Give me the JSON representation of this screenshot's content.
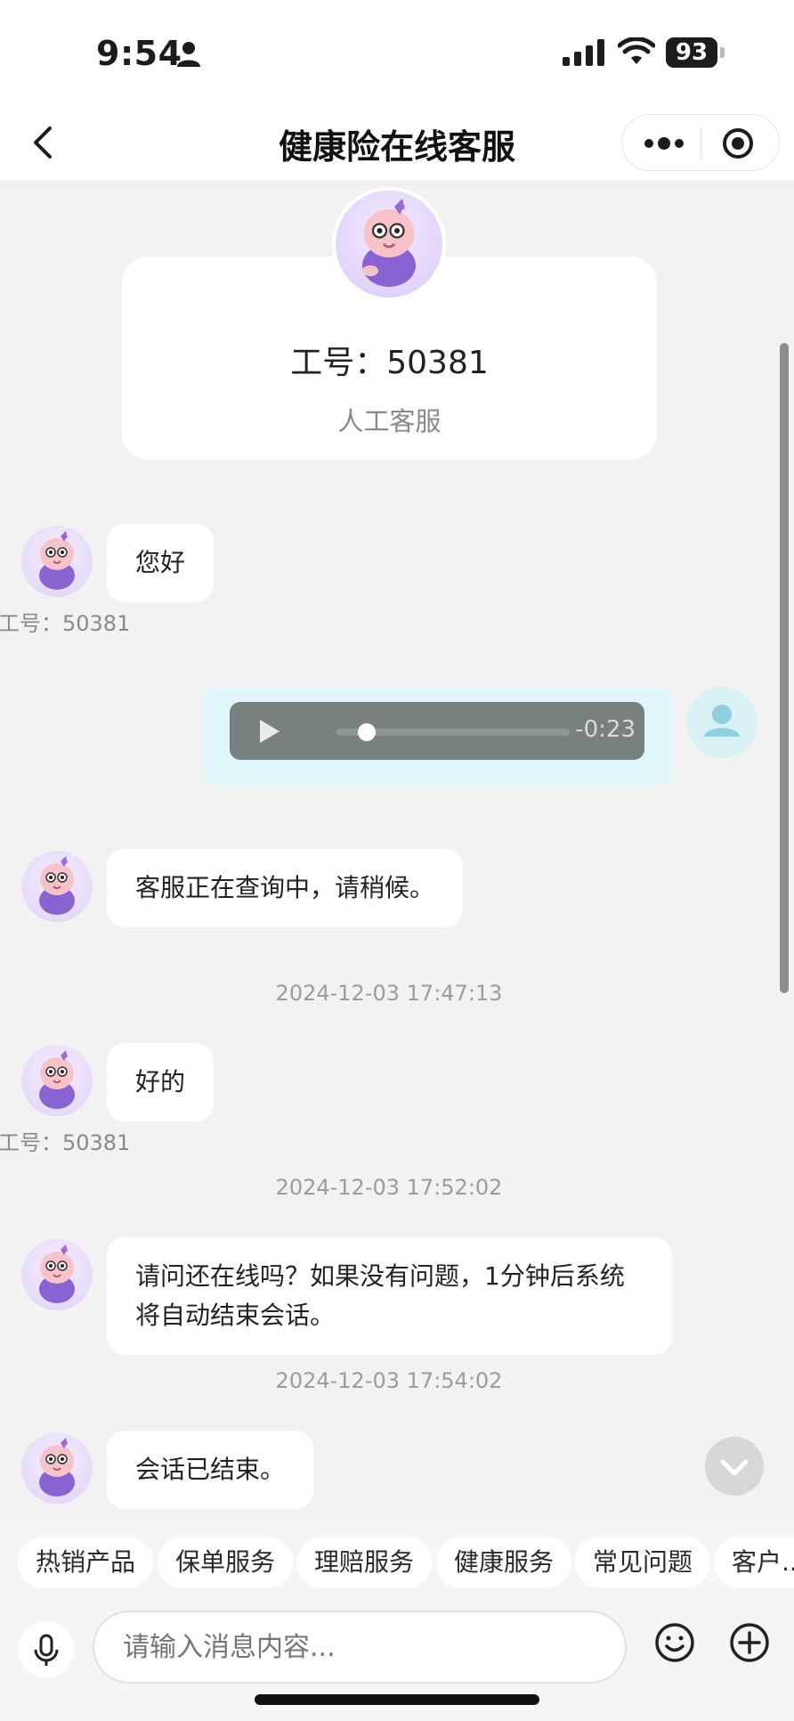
{
  "status_bar": {
    "time": "9:54",
    "battery": "93"
  },
  "nav": {
    "title": "健康险在线客服"
  },
  "agent_card": {
    "id_label": "工号：50381",
    "role": "人工客服"
  },
  "messages": [
    {
      "type": "agent",
      "text": "您好",
      "agent_tag": "工号：50381"
    },
    {
      "type": "user_voice",
      "duration": "-0:23"
    },
    {
      "type": "agent",
      "text": "客服正在查询中，请稍候。"
    },
    {
      "type": "timestamp",
      "text": "2024-12-03 17:47:13"
    },
    {
      "type": "agent",
      "text": "好的",
      "agent_tag": "工号：50381"
    },
    {
      "type": "timestamp",
      "text": "2024-12-03 17:52:02"
    },
    {
      "type": "agent",
      "text": "请问还在线吗？如果没有问题，1分钟后系统将自动结束会话。"
    },
    {
      "type": "timestamp",
      "text": "2024-12-03 17:54:02"
    },
    {
      "type": "agent",
      "text": "会话已结束。"
    }
  ],
  "quick_tabs": [
    "热销产品",
    "保单服务",
    "理赔服务",
    "健康服务",
    "常见问题",
    "客户..."
  ],
  "input": {
    "placeholder": "请输入消息内容..."
  },
  "icons": {
    "back": "chevron-left-icon",
    "more": "more-dots-icon",
    "close": "target-icon",
    "mic": "microphone-icon",
    "emoji": "smiley-icon",
    "plus": "plus-circle-icon",
    "scroll_down": "chevron-down-icon"
  },
  "colors": {
    "user_bubble": "#dff6fa",
    "voice_player": "#78817f",
    "avatar_bg": "#e6daf9"
  }
}
